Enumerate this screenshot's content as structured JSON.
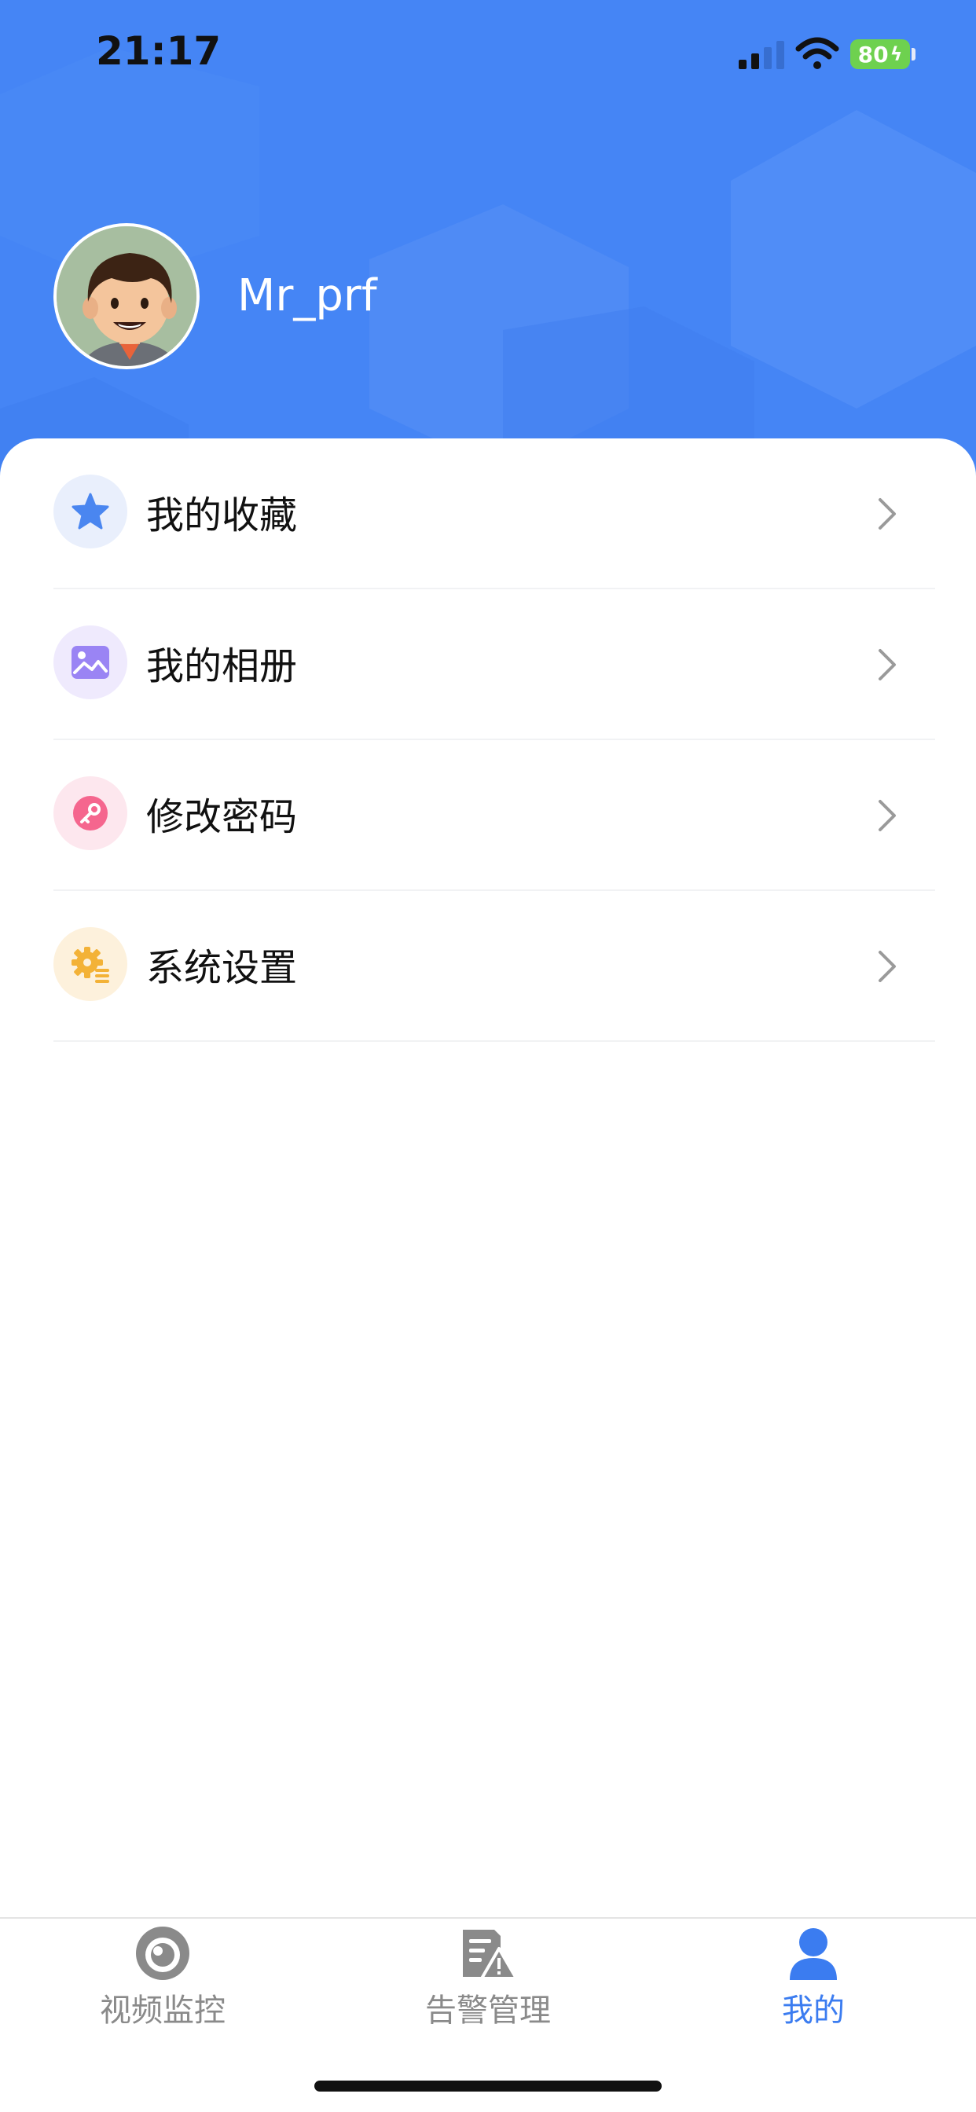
{
  "status_bar": {
    "time": "21:17",
    "battery": "80"
  },
  "profile": {
    "username": "Mr_prf"
  },
  "menu": [
    {
      "label": "我的收藏",
      "icon": "star-icon",
      "color": "#4a86f0",
      "bg": "#e9effc"
    },
    {
      "label": "我的相册",
      "icon": "photo-album-icon",
      "color": "#9a84f4",
      "bg": "#efeafd"
    },
    {
      "label": "修改密码",
      "icon": "key-icon",
      "color": "#f5668e",
      "bg": "#fde7ee"
    },
    {
      "label": "系统设置",
      "icon": "gear-icon",
      "color": "#f3b237",
      "bg": "#fdf1dc"
    }
  ],
  "tabbar": [
    {
      "label": "视频监控",
      "icon": "camera-icon",
      "active": false
    },
    {
      "label": "告警管理",
      "icon": "alarm-doc-icon",
      "active": false
    },
    {
      "label": "我的",
      "icon": "user-icon",
      "active": true
    }
  ],
  "colors": {
    "accent": "#3b7cf0",
    "header_bg": "#4585f5",
    "inactive": "#8a8a8a"
  }
}
